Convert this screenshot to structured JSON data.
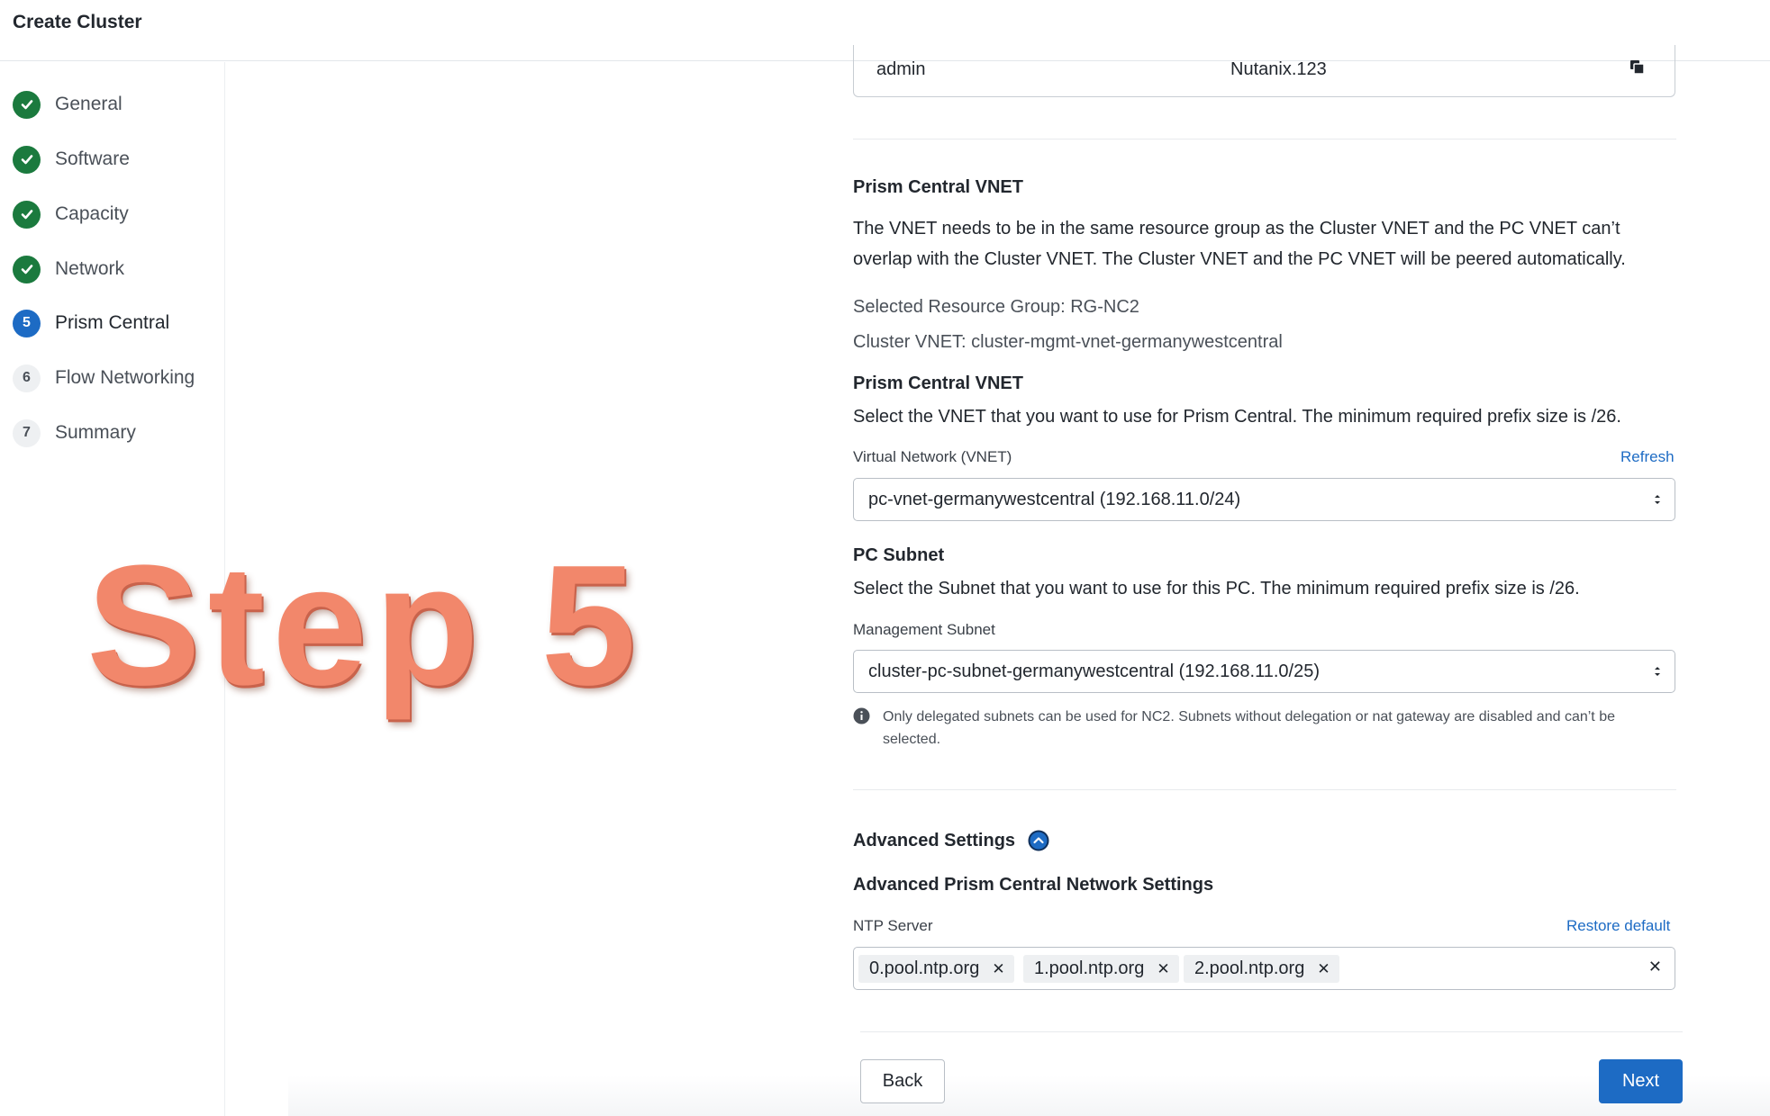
{
  "app": {
    "title": "Create Cluster"
  },
  "steps": [
    {
      "label": "General",
      "status": "done",
      "number": ""
    },
    {
      "label": "Software",
      "status": "done",
      "number": ""
    },
    {
      "label": "Capacity",
      "status": "done",
      "number": ""
    },
    {
      "label": "Network",
      "status": "done",
      "number": ""
    },
    {
      "label": "Prism Central",
      "status": "current",
      "number": "5"
    },
    {
      "label": "Flow Networking",
      "status": "pending",
      "number": "6"
    },
    {
      "label": "Summary",
      "status": "pending",
      "number": "7"
    }
  ],
  "overlay": {
    "text": "Step 5"
  },
  "credentials": {
    "username": "admin",
    "password": "Nutanix.123"
  },
  "vnet_section": {
    "heading": "Prism Central VNET",
    "description": "The VNET needs to be in the same resource group as the Cluster VNET and the PC VNET can’t overlap with the Cluster VNET. The Cluster VNET and the PC VNET will be peered automatically.",
    "resource_group": "Selected Resource Group: RG-NC2",
    "cluster_vnet": "Cluster VNET: cluster-mgmt-vnet-germanywestcentral",
    "sub_heading": "Prism Central VNET",
    "sub_description": "Select the VNET that you want to use for Prism Central. The minimum required prefix size is /26.",
    "field_label": "Virtual Network (VNET)",
    "refresh_label": "Refresh",
    "selected_vnet": "pc-vnet-germanywestcentral (192.168.11.0/24)"
  },
  "subnet_section": {
    "heading": "PC Subnet",
    "description": "Select the Subnet that you want to use for this PC. The minimum required prefix size is /26.",
    "field_label": "Management Subnet",
    "selected_subnet": "cluster-pc-subnet-germanywestcentral (192.168.11.0/25)",
    "info": "Only delegated subnets can be used for NC2. Subnets without delegation or nat gateway are disabled and can’t be selected."
  },
  "advanced": {
    "title": "Advanced Settings",
    "sub_heading": "Advanced Prism Central Network Settings",
    "ntp_label": "NTP Server",
    "restore_label": "Restore default",
    "ntp_servers": [
      "0.pool.ntp.org",
      "1.pool.ntp.org",
      "2.pool.ntp.org"
    ]
  },
  "footer": {
    "back_label": "Back",
    "next_label": "Next"
  },
  "colors": {
    "accent": "#1d6bc4",
    "success": "#1b7a3e",
    "overlay": "#f2876b"
  }
}
